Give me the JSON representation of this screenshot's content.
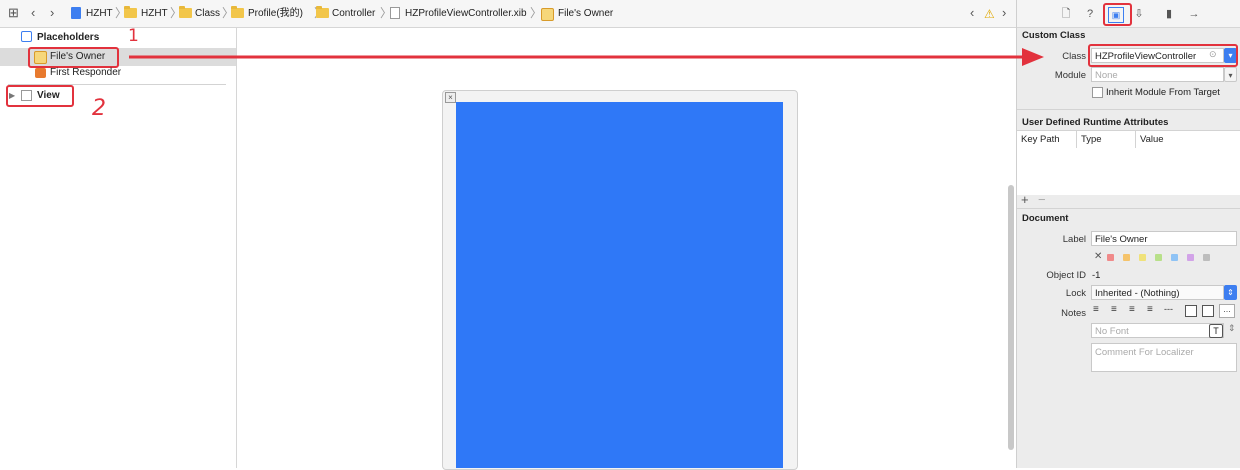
{
  "jumpbar": {
    "items": [
      "HZHT",
      "HZHT",
      "Class",
      "Profile(我的)",
      "Controller",
      "HZProfileViewController.xib",
      "File's Owner"
    ]
  },
  "outline": {
    "placeholders_label": "Placeholders",
    "files_owner_label": "File's Owner",
    "first_responder_label": "First Responder",
    "view_label": "View"
  },
  "annotations": {
    "one": "1",
    "two": "2"
  },
  "inspector": {
    "custom_class": {
      "title": "Custom Class",
      "class_label": "Class",
      "class_value": "HZProfileViewController",
      "module_label": "Module",
      "module_placeholder": "None",
      "inherit_label": "Inherit Module From Target"
    },
    "runtime_attrs": {
      "title": "User Defined Runtime Attributes",
      "columns": [
        "Key Path",
        "Type",
        "Value"
      ],
      "add": "+",
      "remove": "−"
    },
    "document": {
      "title": "Document",
      "label_label": "Label",
      "label_value": "File's Owner",
      "object_id_label": "Object ID",
      "object_id_value": "-1",
      "lock_label": "Lock",
      "lock_value": "Inherited - (Nothing)",
      "notes_label": "Notes",
      "font_placeholder": "No Font",
      "comment_placeholder": "Comment For Localizer",
      "swatch_colors": [
        "#f08a8a",
        "#f5c36b",
        "#f0e27a",
        "#b8e08a",
        "#8fc3f5",
        "#d2a3e8",
        "#bdbdbd"
      ]
    }
  },
  "colors": {
    "accent": "#3d7ef0",
    "view_blue": "#2f78f7",
    "annotation_red": "#e2323d"
  }
}
